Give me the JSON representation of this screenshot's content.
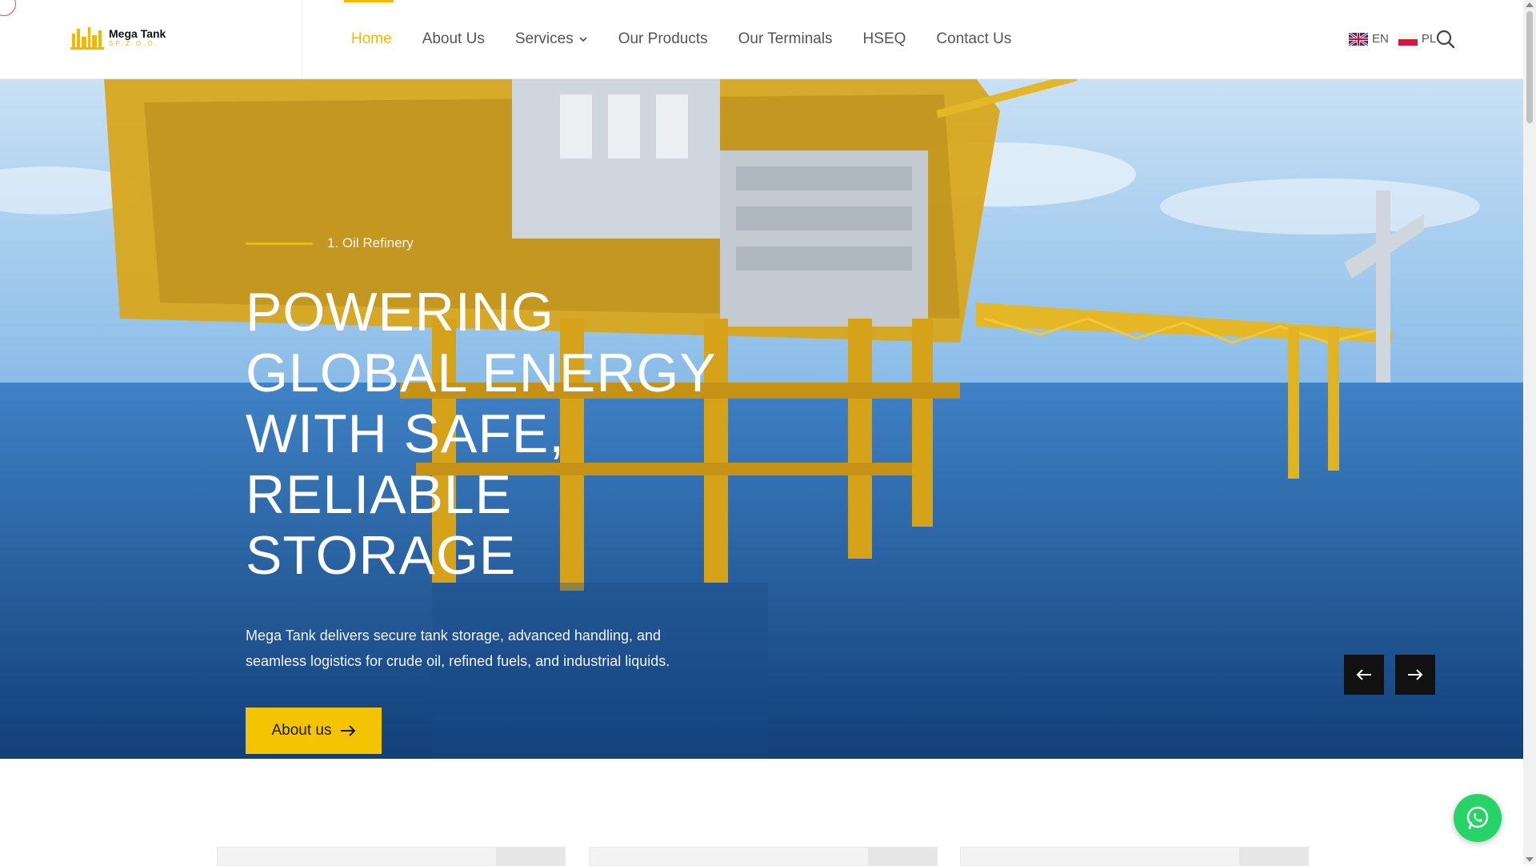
{
  "brand": {
    "name": "Mega Tank",
    "sub": "SP.Z O.O.",
    "accent": "#f5b800"
  },
  "nav": {
    "items": [
      {
        "label": "Home",
        "active": true
      },
      {
        "label": "About Us"
      },
      {
        "label": "Services",
        "has_dropdown": true
      },
      {
        "label": "Our Products"
      },
      {
        "label": "Our Terminals"
      },
      {
        "label": "HSEQ"
      },
      {
        "label": "Contact Us"
      }
    ]
  },
  "lang": {
    "en": "EN",
    "pl": "PL"
  },
  "icons": {
    "search": "search-icon",
    "whatsapp": "whatsapp-icon",
    "prev": "arrow-left-icon",
    "next": "arrow-right-icon"
  },
  "hero": {
    "kicker": "1. Oil Refinery",
    "title": "POWERING GLOBAL ENERGY WITH SAFE, RELIABLE STORAGE",
    "description": "Mega Tank delivers secure tank storage, advanced handling, and seamless logistics for crude oil, refined fuels, and industrial liquids.",
    "cta_label": "About us"
  },
  "colors": {
    "cta_bg": "#f5c400",
    "slider_btn": "#111111",
    "whatsapp": "#25d366"
  }
}
